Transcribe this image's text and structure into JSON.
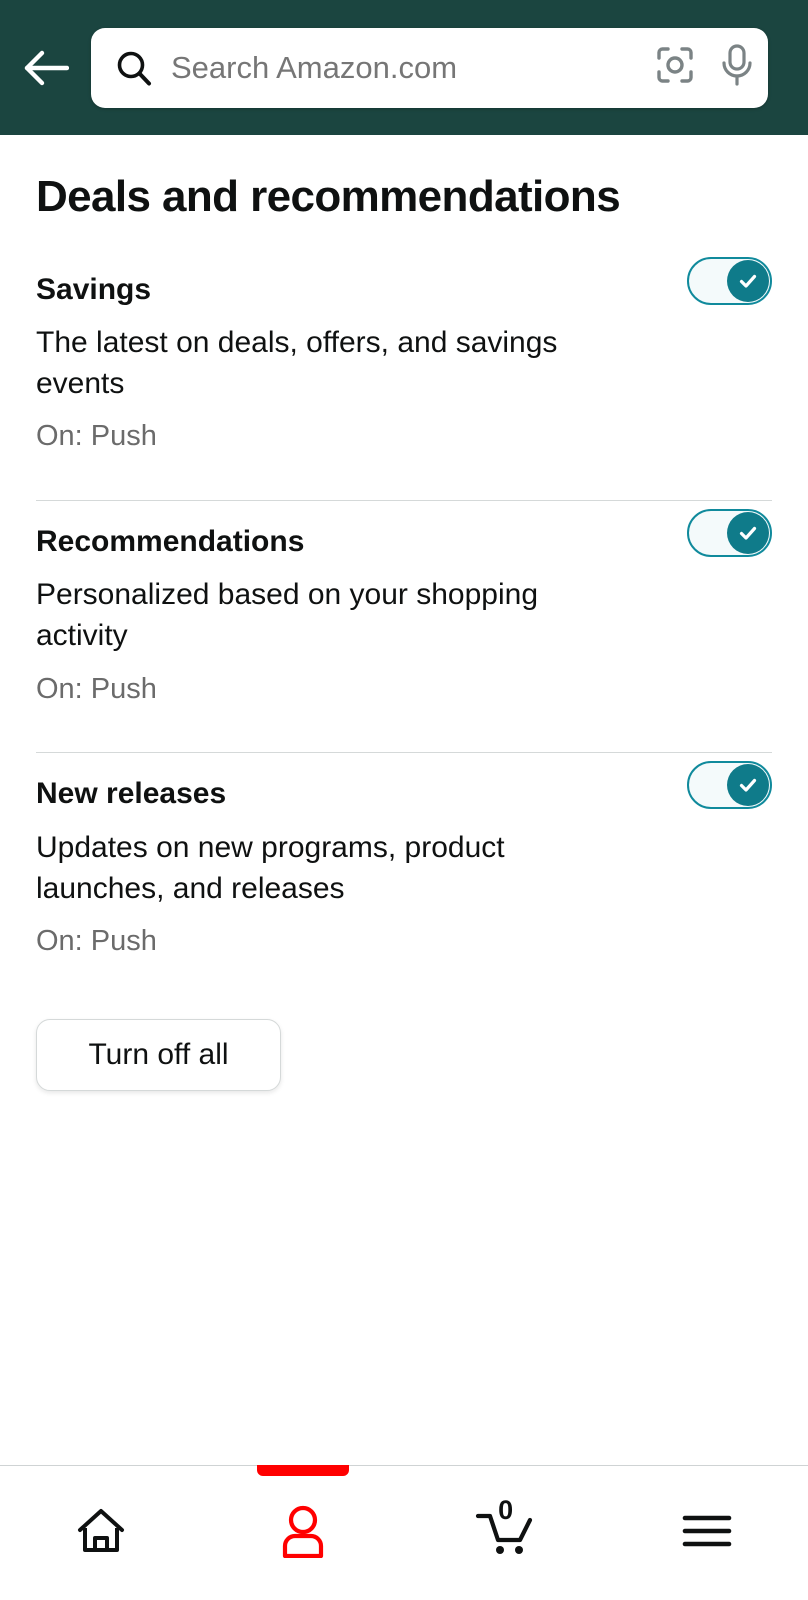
{
  "header": {
    "background_color": "#1b4540",
    "back_label": "Back",
    "back_icon": "arrow-left-icon",
    "search": {
      "placeholder": "Search Amazon.com",
      "value": "",
      "search_icon": "search-icon",
      "lens_icon": "camera-lens-scan-icon",
      "mic_icon": "microphone-icon"
    }
  },
  "main": {
    "title": "Deals and recommendations",
    "preferences": [
      {
        "title": "Savings",
        "description": "The latest on deals, offers, and savings events",
        "status": "On: Push",
        "toggle_on": true,
        "toggle_label": "Savings notifications toggle"
      },
      {
        "title": "Recommendations",
        "description": "Personalized based on your shopping activity",
        "status": "On: Push",
        "toggle_on": true,
        "toggle_label": "Recommendations notifications toggle"
      },
      {
        "title": "New releases",
        "description": "Updates on new programs, product launches, and releases",
        "status": "On: Push",
        "toggle_on": true,
        "toggle_label": "New releases notifications toggle"
      }
    ],
    "turn_off_all_label": "Turn off all"
  },
  "bottom_nav": {
    "items": [
      {
        "name": "home",
        "icon": "home-icon",
        "active": false,
        "badge": ""
      },
      {
        "name": "account",
        "icon": "person-icon",
        "active": true,
        "badge": ""
      },
      {
        "name": "cart",
        "icon": "shopping-cart-icon",
        "active": false,
        "badge": "0"
      },
      {
        "name": "menu",
        "icon": "hamburger-menu-icon",
        "active": false,
        "badge": ""
      }
    ]
  },
  "colors": {
    "header_green": "#1b4540",
    "toggle_border": "#108a9c",
    "toggle_knob": "#0f7b8a",
    "toggle_track": "#f4fafb",
    "active_nav_red": "#ff0000",
    "text_primary": "#0f1111",
    "text_secondary": "#6b6b6b",
    "divider": "#d5d9d9"
  }
}
